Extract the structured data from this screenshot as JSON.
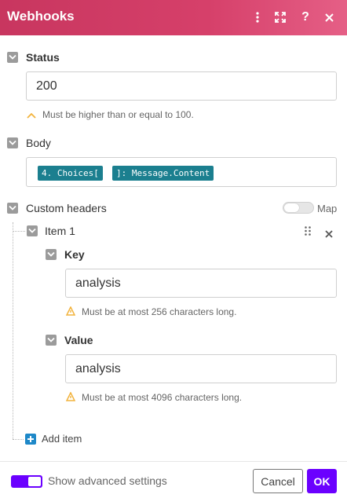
{
  "header": {
    "title": "Webhooks"
  },
  "status": {
    "label": "Status",
    "value": "200",
    "hint": "Must be higher than or equal to 100."
  },
  "body": {
    "label": "Body",
    "tokens": [
      "4. Choices[",
      "]: Message.Content"
    ]
  },
  "custom_headers": {
    "label": "Custom headers",
    "map_label": "Map",
    "item": {
      "label": "Item 1",
      "key": {
        "label": "Key",
        "value": "analysis",
        "hint": "Must be at most 256 characters long."
      },
      "value": {
        "label": "Value",
        "value": "analysis",
        "hint": "Must be at most 4096 characters long."
      }
    },
    "add_item_label": "Add item"
  },
  "footer": {
    "advanced_label": "Show advanced settings",
    "cancel_label": "Cancel",
    "ok_label": "OK"
  },
  "colors": {
    "header_start": "#c8365f",
    "header_end": "#e55f86",
    "token_bg": "#1b7f8f",
    "accent": "#6b00ff",
    "add_icon": "#1e88c8",
    "hint_icon": "#f2b33d"
  },
  "icons": [
    "kebab-menu-icon",
    "expand-icon",
    "help-icon",
    "close-icon",
    "chevron-down-icon",
    "chevron-up-icon",
    "warning-icon",
    "drag-handle-icon",
    "remove-icon",
    "plus-icon"
  ]
}
